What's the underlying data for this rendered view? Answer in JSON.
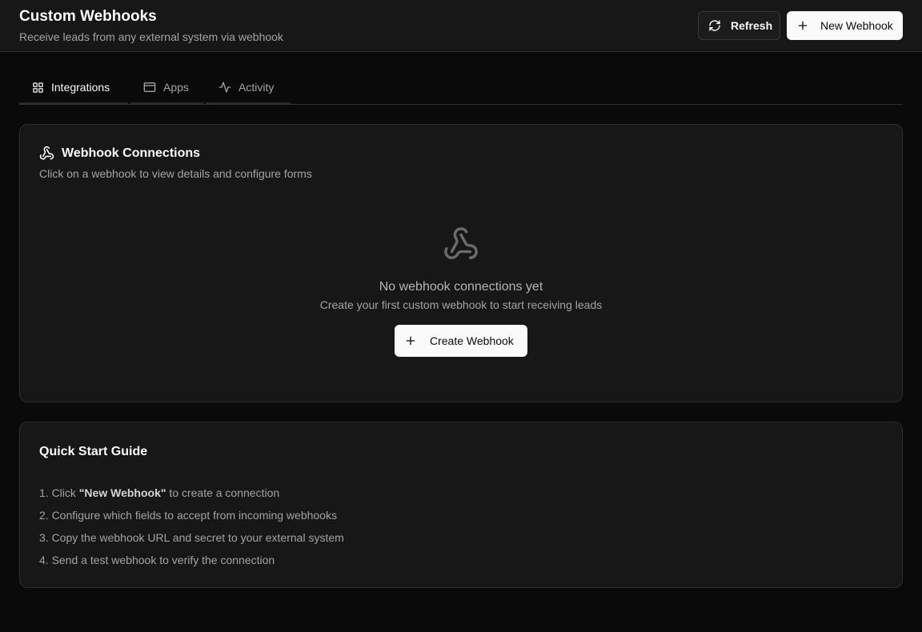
{
  "header": {
    "title": "Custom Webhooks",
    "subtitle": "Receive leads from any external system via webhook",
    "refresh_label": "Refresh",
    "new_webhook_label": "New Webhook"
  },
  "tabs": [
    {
      "label": "Integrations",
      "icon": "grid-icon",
      "active": true
    },
    {
      "label": "Apps",
      "icon": "window-icon",
      "active": false
    },
    {
      "label": "Activity",
      "icon": "activity-icon",
      "active": false
    }
  ],
  "connections": {
    "title": "Webhook Connections",
    "description": "Click on a webhook to view details and configure forms",
    "empty_title": "No webhook connections yet",
    "empty_subtitle": "Create your first custom webhook to start receiving leads",
    "create_label": "Create Webhook"
  },
  "guide": {
    "title": "Quick Start Guide",
    "steps": [
      {
        "prefix": "1. Click ",
        "bold": "\"New Webhook\"",
        "suffix": " to create a connection"
      },
      {
        "text": "2. Configure which fields to accept from incoming webhooks"
      },
      {
        "text": "3. Copy the webhook URL and secret to your external system"
      },
      {
        "text": "4. Send a test webhook to verify the connection"
      }
    ]
  },
  "colors": {
    "background": "#0a0a0a",
    "surface": "#171717",
    "border": "#2e2e2e",
    "primary_button": "#fafafa",
    "muted_text": "#a3a3a3"
  }
}
